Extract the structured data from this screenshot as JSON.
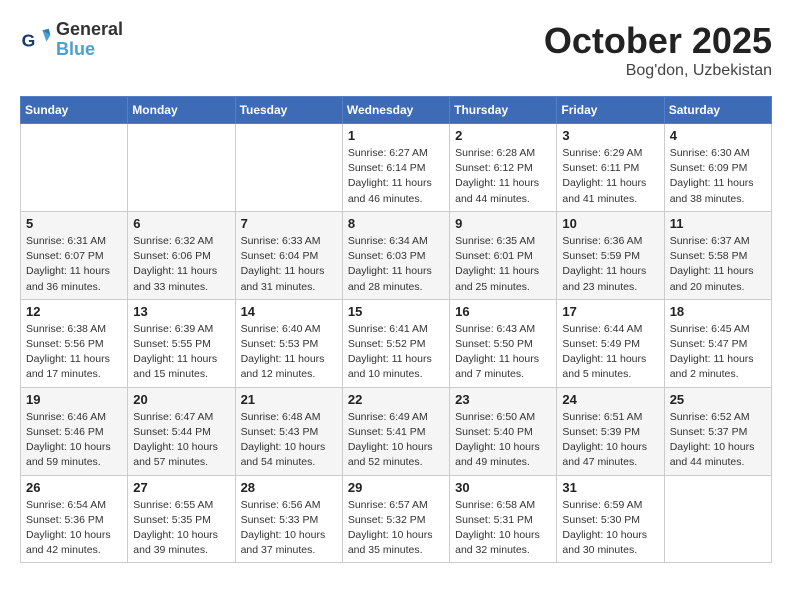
{
  "header": {
    "logo_line1": "General",
    "logo_line2": "Blue",
    "title": "October 2025",
    "subtitle": "Bog'don, Uzbekistan"
  },
  "weekdays": [
    "Sunday",
    "Monday",
    "Tuesday",
    "Wednesday",
    "Thursday",
    "Friday",
    "Saturday"
  ],
  "weeks": [
    [
      null,
      null,
      null,
      {
        "day": 1,
        "sunrise": "6:27 AM",
        "sunset": "6:14 PM",
        "daylight": "11 hours and 46 minutes."
      },
      {
        "day": 2,
        "sunrise": "6:28 AM",
        "sunset": "6:12 PM",
        "daylight": "11 hours and 44 minutes."
      },
      {
        "day": 3,
        "sunrise": "6:29 AM",
        "sunset": "6:11 PM",
        "daylight": "11 hours and 41 minutes."
      },
      {
        "day": 4,
        "sunrise": "6:30 AM",
        "sunset": "6:09 PM",
        "daylight": "11 hours and 38 minutes."
      }
    ],
    [
      {
        "day": 5,
        "sunrise": "6:31 AM",
        "sunset": "6:07 PM",
        "daylight": "11 hours and 36 minutes."
      },
      {
        "day": 6,
        "sunrise": "6:32 AM",
        "sunset": "6:06 PM",
        "daylight": "11 hours and 33 minutes."
      },
      {
        "day": 7,
        "sunrise": "6:33 AM",
        "sunset": "6:04 PM",
        "daylight": "11 hours and 31 minutes."
      },
      {
        "day": 8,
        "sunrise": "6:34 AM",
        "sunset": "6:03 PM",
        "daylight": "11 hours and 28 minutes."
      },
      {
        "day": 9,
        "sunrise": "6:35 AM",
        "sunset": "6:01 PM",
        "daylight": "11 hours and 25 minutes."
      },
      {
        "day": 10,
        "sunrise": "6:36 AM",
        "sunset": "5:59 PM",
        "daylight": "11 hours and 23 minutes."
      },
      {
        "day": 11,
        "sunrise": "6:37 AM",
        "sunset": "5:58 PM",
        "daylight": "11 hours and 20 minutes."
      }
    ],
    [
      {
        "day": 12,
        "sunrise": "6:38 AM",
        "sunset": "5:56 PM",
        "daylight": "11 hours and 17 minutes."
      },
      {
        "day": 13,
        "sunrise": "6:39 AM",
        "sunset": "5:55 PM",
        "daylight": "11 hours and 15 minutes."
      },
      {
        "day": 14,
        "sunrise": "6:40 AM",
        "sunset": "5:53 PM",
        "daylight": "11 hours and 12 minutes."
      },
      {
        "day": 15,
        "sunrise": "6:41 AM",
        "sunset": "5:52 PM",
        "daylight": "11 hours and 10 minutes."
      },
      {
        "day": 16,
        "sunrise": "6:43 AM",
        "sunset": "5:50 PM",
        "daylight": "11 hours and 7 minutes."
      },
      {
        "day": 17,
        "sunrise": "6:44 AM",
        "sunset": "5:49 PM",
        "daylight": "11 hours and 5 minutes."
      },
      {
        "day": 18,
        "sunrise": "6:45 AM",
        "sunset": "5:47 PM",
        "daylight": "11 hours and 2 minutes."
      }
    ],
    [
      {
        "day": 19,
        "sunrise": "6:46 AM",
        "sunset": "5:46 PM",
        "daylight": "10 hours and 59 minutes."
      },
      {
        "day": 20,
        "sunrise": "6:47 AM",
        "sunset": "5:44 PM",
        "daylight": "10 hours and 57 minutes."
      },
      {
        "day": 21,
        "sunrise": "6:48 AM",
        "sunset": "5:43 PM",
        "daylight": "10 hours and 54 minutes."
      },
      {
        "day": 22,
        "sunrise": "6:49 AM",
        "sunset": "5:41 PM",
        "daylight": "10 hours and 52 minutes."
      },
      {
        "day": 23,
        "sunrise": "6:50 AM",
        "sunset": "5:40 PM",
        "daylight": "10 hours and 49 minutes."
      },
      {
        "day": 24,
        "sunrise": "6:51 AM",
        "sunset": "5:39 PM",
        "daylight": "10 hours and 47 minutes."
      },
      {
        "day": 25,
        "sunrise": "6:52 AM",
        "sunset": "5:37 PM",
        "daylight": "10 hours and 44 minutes."
      }
    ],
    [
      {
        "day": 26,
        "sunrise": "6:54 AM",
        "sunset": "5:36 PM",
        "daylight": "10 hours and 42 minutes."
      },
      {
        "day": 27,
        "sunrise": "6:55 AM",
        "sunset": "5:35 PM",
        "daylight": "10 hours and 39 minutes."
      },
      {
        "day": 28,
        "sunrise": "6:56 AM",
        "sunset": "5:33 PM",
        "daylight": "10 hours and 37 minutes."
      },
      {
        "day": 29,
        "sunrise": "6:57 AM",
        "sunset": "5:32 PM",
        "daylight": "10 hours and 35 minutes."
      },
      {
        "day": 30,
        "sunrise": "6:58 AM",
        "sunset": "5:31 PM",
        "daylight": "10 hours and 32 minutes."
      },
      {
        "day": 31,
        "sunrise": "6:59 AM",
        "sunset": "5:30 PM",
        "daylight": "10 hours and 30 minutes."
      },
      null
    ]
  ]
}
